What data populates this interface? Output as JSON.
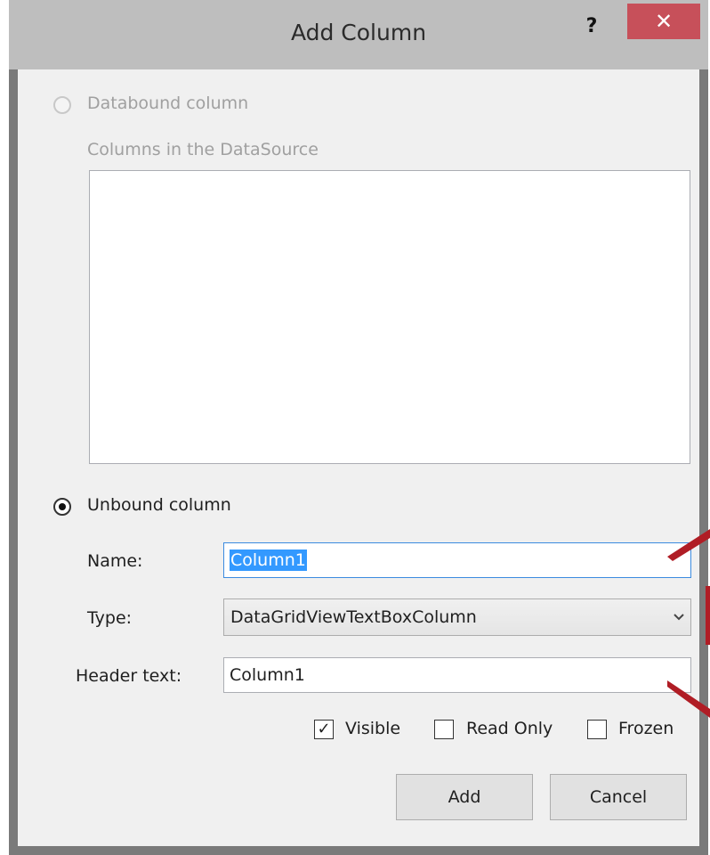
{
  "window": {
    "title": "Add Column",
    "help_label": "?",
    "close_label": "✕"
  },
  "databound": {
    "radio_label": "Databound column",
    "list_label": "Columns in the DataSource",
    "selected": false,
    "enabled": false
  },
  "unbound": {
    "radio_label": "Unbound column",
    "selected": true
  },
  "fields": {
    "name_label": "Name:",
    "name_value": "Column1",
    "type_label": "Type:",
    "type_value": "DataGridViewTextBoxColumn",
    "header_label": "Header text:",
    "header_value": "Column1"
  },
  "options": {
    "visible_label": "Visible",
    "visible_checked": true,
    "readonly_label": "Read Only",
    "readonly_checked": false,
    "frozen_label": "Frozen",
    "frozen_checked": false,
    "check_mark": "✓"
  },
  "buttons": {
    "add_label": "Add",
    "cancel_label": "Cancel"
  },
  "colors": {
    "close_button": "#c7505a",
    "callout": "#b01d25",
    "focus_border": "#3c8be0",
    "selection": "#3399ff"
  },
  "icons": {
    "dropdown": "chevron-down-icon"
  }
}
